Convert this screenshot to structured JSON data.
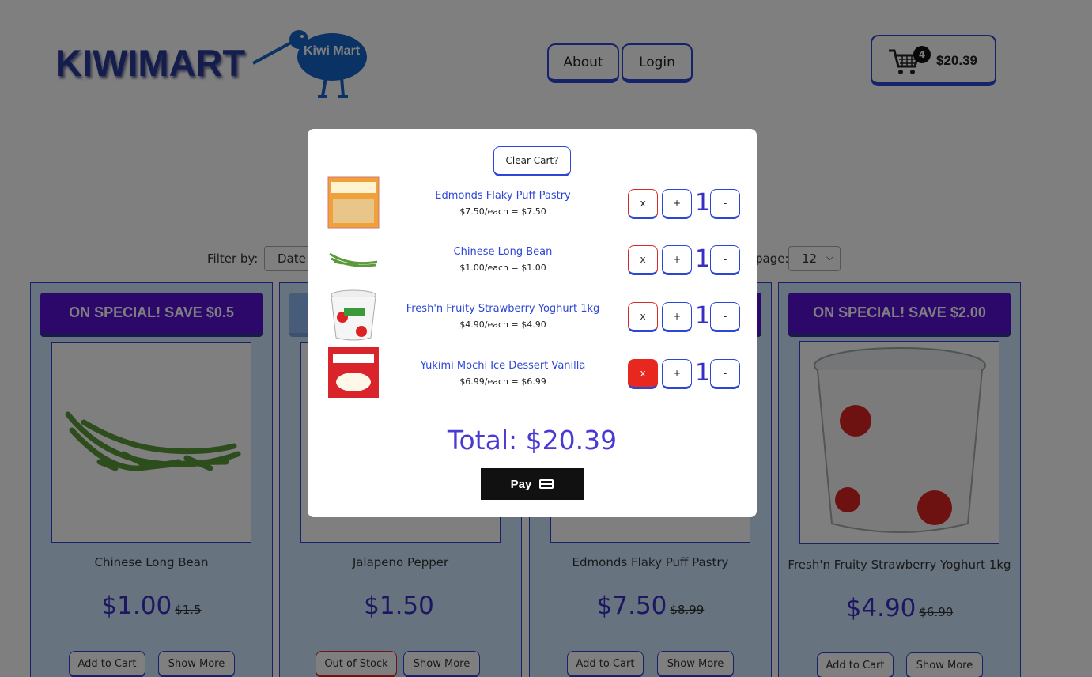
{
  "header": {
    "logo_text": "KIWIMART",
    "logo_bird_label": "Kiwi Mart",
    "nav": [
      {
        "label": "About"
      },
      {
        "label": "Login"
      }
    ],
    "cart": {
      "count": "4",
      "total": "$20.39"
    }
  },
  "filters": {
    "filter_label": "Filter by:",
    "filter_value": "Date",
    "per_page_label": "page:",
    "per_page_value": "12"
  },
  "products": [
    {
      "banner": "ON SPECIAL! SAVE $0.5",
      "name": "Chinese Long Bean",
      "price": "$1.00",
      "old_price": "$1.5",
      "primary_button": "Add to Cart",
      "secondary_button": "Show More"
    },
    {
      "banner": "",
      "name": "Jalapeno Pepper",
      "price": "$1.50",
      "old_price": "",
      "primary_button": "Out of Stock",
      "secondary_button": "Show More"
    },
    {
      "banner": "",
      "name": "Edmonds Flaky Puff Pastry",
      "price": "$7.50",
      "old_price": "$8.99",
      "primary_button": "Add to Cart",
      "secondary_button": "Show More"
    },
    {
      "banner": "ON SPECIAL! SAVE $2.00",
      "name": "Fresh'n Fruity Strawberry Yoghurt 1kg",
      "price": "$4.90",
      "old_price": "$6.90",
      "primary_button": "Add to Cart",
      "secondary_button": "Show More"
    }
  ],
  "modal": {
    "clear_cart_label": "Clear Cart?",
    "items": [
      {
        "name": "Edmonds Flaky Puff Pastry",
        "price_line": "$7.50/each = $7.50",
        "remove_label": "x",
        "plus_label": "+",
        "quantity": "1",
        "minus_label": "-"
      },
      {
        "name": "Chinese Long Bean",
        "price_line": "$1.00/each = $1.00",
        "remove_label": "x",
        "plus_label": "+",
        "quantity": "1",
        "minus_label": "-"
      },
      {
        "name": "Fresh'n Fruity Strawberry Yoghurt 1kg",
        "price_line": "$4.90/each = $4.90",
        "remove_label": "x",
        "plus_label": "+",
        "quantity": "1",
        "minus_label": "-"
      },
      {
        "name": "Yukimi Mochi Ice Dessert Vanilla",
        "price_line": "$6.99/each = $6.99",
        "remove_label": "x",
        "plus_label": "+",
        "quantity": "1",
        "minus_label": "-"
      }
    ],
    "total_label": "Total: $20.39",
    "pay_label": "Pay"
  },
  "colors": {
    "accent": "#2c46d6",
    "special_banner": "#5a10d6",
    "price": "#3a2fc4",
    "remove_active": "#e8271e"
  }
}
